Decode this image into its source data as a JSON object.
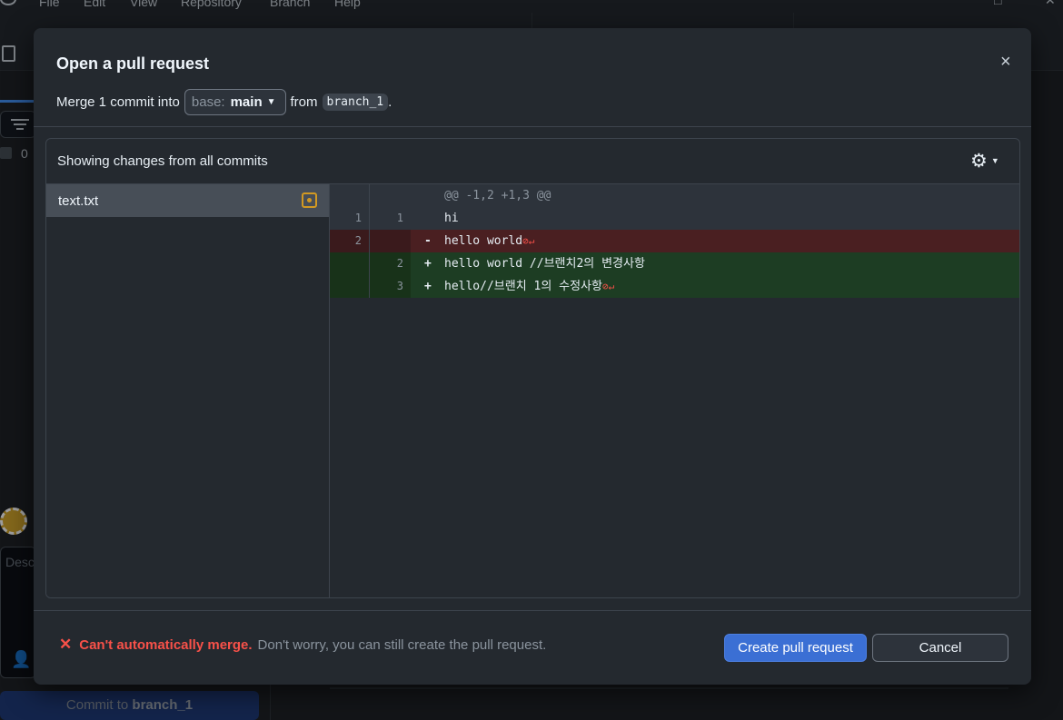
{
  "menubar": {
    "items": [
      "File",
      "Edit",
      "View",
      "Repository",
      "Branch",
      "Help"
    ]
  },
  "sidebar": {
    "changes_count": "0",
    "description_placeholder": "Desc",
    "commit_prefix": "Commit to",
    "commit_branch": "branch_1"
  },
  "dialog": {
    "title": "Open a pull request",
    "close_icon": "×",
    "merge_prefix": "Merge 1 commit into",
    "base_label": "base:",
    "base_branch": "main",
    "from_label": "from",
    "head_branch": "branch_1",
    "period": "."
  },
  "changes": {
    "title": "Showing changes from all commits",
    "gear_icon": "⚙",
    "files": [
      {
        "name": "text.txt",
        "status": "modified"
      }
    ]
  },
  "diff": {
    "hunk": "@@ -1,2 +1,3 @@",
    "lines": [
      {
        "type": "context",
        "old": "1",
        "new": "1",
        "marker": "",
        "text": "hi",
        "no_newline": false
      },
      {
        "type": "deletion",
        "old": "2",
        "new": "",
        "marker": "-",
        "text": "hello world",
        "no_newline": true
      },
      {
        "type": "addition",
        "old": "",
        "new": "2",
        "marker": "+",
        "text": "hello world //브랜치2의 변경사항",
        "no_newline": false
      },
      {
        "type": "addition",
        "old": "",
        "new": "3",
        "marker": "+",
        "text": "hello//브랜치 1의 수정사항",
        "no_newline": true
      }
    ],
    "no_newline_glyph": "⊘↵"
  },
  "footer": {
    "x_icon": "✕",
    "status_strong": "Can't automatically merge.",
    "status_note": "Don't worry, you can still create the pull request.",
    "create_label": "Create pull request",
    "cancel_label": "Cancel"
  },
  "colors": {
    "error": "#f85149",
    "primary_button": "#3b6fd4",
    "modified": "#d29922"
  }
}
